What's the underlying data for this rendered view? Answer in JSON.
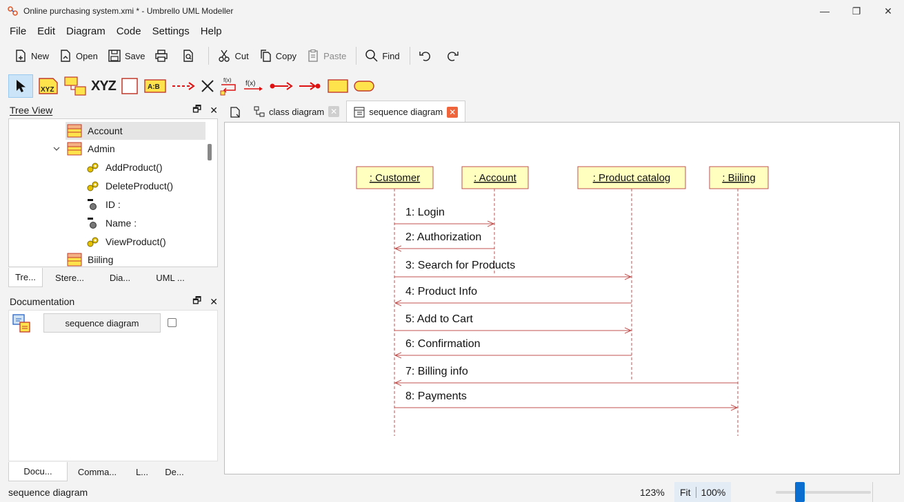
{
  "window": {
    "title": "Online purchasing system.xmi * - Umbrello UML Modeller",
    "controls": {
      "minimize": "—",
      "restore": "❐",
      "close": "✕"
    }
  },
  "menu": [
    "File",
    "Edit",
    "Diagram",
    "Code",
    "Settings",
    "Help"
  ],
  "toolbar": {
    "new": "New",
    "open": "Open",
    "save": "Save",
    "cut": "Cut",
    "copy": "Copy",
    "paste": "Paste",
    "find": "Find"
  },
  "diagram_toolbar": {
    "object_label": "XYZ"
  },
  "tree_view": {
    "title": "Tree View",
    "items": [
      {
        "label": "Account",
        "kind": "class"
      },
      {
        "label": "Admin",
        "kind": "class-expanded"
      },
      {
        "label": "AddProduct()",
        "kind": "operation"
      },
      {
        "label": "DeleteProduct()",
        "kind": "operation"
      },
      {
        "label": "ID :",
        "kind": "attribute"
      },
      {
        "label": "Name :",
        "kind": "attribute"
      },
      {
        "label": "ViewProduct()",
        "kind": "operation"
      },
      {
        "label": "Biiling",
        "kind": "class"
      }
    ],
    "tabs": [
      "Tre...",
      "Stere...",
      "Dia...",
      "UML ..."
    ]
  },
  "documentation": {
    "title": "Documentation",
    "button": "sequence diagram",
    "tabs": [
      "Docu...",
      "Comma...",
      "L...",
      "De..."
    ]
  },
  "diagram_tabs": [
    {
      "label": "class diagram",
      "active": false
    },
    {
      "label": "sequence diagram",
      "active": true
    }
  ],
  "sequence": {
    "objects": [
      ": Customer",
      ": Account",
      ": Product catalog",
      ": Biiling"
    ],
    "messages": [
      {
        "label": "1: Login",
        "from": 0,
        "to": 1
      },
      {
        "label": "2: Authorization",
        "from": 1,
        "to": 0
      },
      {
        "label": "3: Search for Products",
        "from": 0,
        "to": 2
      },
      {
        "label": "4: Product Info",
        "from": 2,
        "to": 0
      },
      {
        "label": "5: Add to Cart",
        "from": 0,
        "to": 2
      },
      {
        "label": "6: Confirmation",
        "from": 2,
        "to": 0
      },
      {
        "label": "7: Billing info",
        "from": 3,
        "to": 0
      },
      {
        "label": "8: Payments",
        "from": 0,
        "to": 3
      }
    ]
  },
  "status": {
    "text": "sequence diagram",
    "zoom": "123%",
    "fit": "Fit",
    "hundred": "100%"
  },
  "colors": {
    "accent": "#0a6ed1",
    "object_fill": "#ffffc0",
    "object_border": "#c0504d",
    "message_line": "#c0504d",
    "close_active": "#f0643c",
    "close_inactive": "#cfcfcf"
  }
}
